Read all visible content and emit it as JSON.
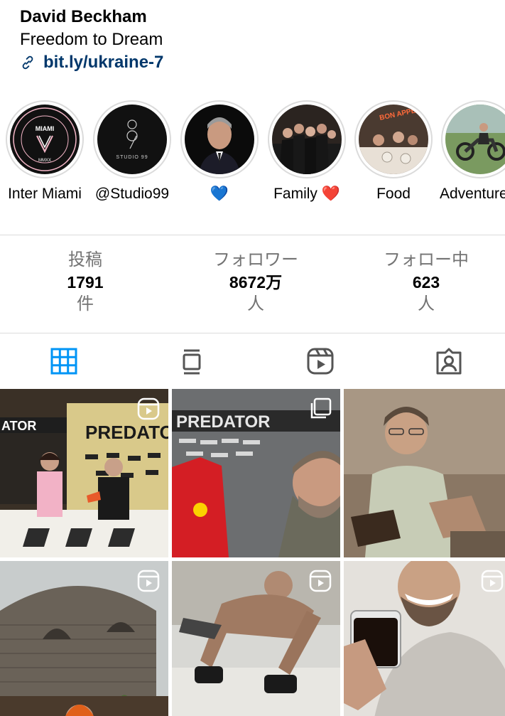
{
  "profile": {
    "name": "David Beckham",
    "tagline": "Freedom to Dream",
    "link": "bit.ly/ukraine-7"
  },
  "stories": [
    {
      "label": "Inter Miami",
      "icon": "inter-miami-crest"
    },
    {
      "label": "@Studio99",
      "icon": "studio99-logo"
    },
    {
      "label": "💙",
      "icon": "portrait"
    },
    {
      "label": "Family ❤️",
      "icon": "group-photo"
    },
    {
      "label": "Food",
      "icon": "restaurant-photo"
    },
    {
      "label": "Adventure",
      "icon": "motorcycle-photo"
    }
  ],
  "story_art": {
    "miami_top": "MIAMI",
    "miami_bottom": "MMXX",
    "miami_ring": "INTERNACIONAL CLUB DE FUTBOL",
    "studio_text": "STUDIO 99",
    "food_sign": "BON APPETIT"
  },
  "stats": [
    {
      "label": "投稿",
      "value": "1791",
      "unit": "件"
    },
    {
      "label": "フォロワー",
      "value": "8672万",
      "unit": "人"
    },
    {
      "label": "フォロー中",
      "value": "623",
      "unit": "人"
    }
  ],
  "tabs": [
    {
      "name": "grid",
      "icon": "grid-icon",
      "active": true
    },
    {
      "name": "feed",
      "icon": "feed-icon",
      "active": false
    },
    {
      "name": "reels",
      "icon": "reels-icon",
      "active": false
    },
    {
      "name": "tagged",
      "icon": "tagged-icon",
      "active": false
    }
  ],
  "posts": [
    {
      "type": "reel",
      "scene": "predator-event",
      "sign": "PREDATOR",
      "sign2": "ATOR"
    },
    {
      "type": "carousel",
      "scene": "shirt-selfie",
      "sign": "PREDATOR"
    },
    {
      "type": "photo",
      "scene": "reading-portrait"
    },
    {
      "type": "reel",
      "scene": "garden-hut"
    },
    {
      "type": "reel",
      "scene": "pushups"
    },
    {
      "type": "reel",
      "scene": "coffee"
    }
  ],
  "colors": {
    "accent": "#0095f6",
    "link": "#00376b",
    "muted": "#737373",
    "divider": "#dbdbdb"
  }
}
